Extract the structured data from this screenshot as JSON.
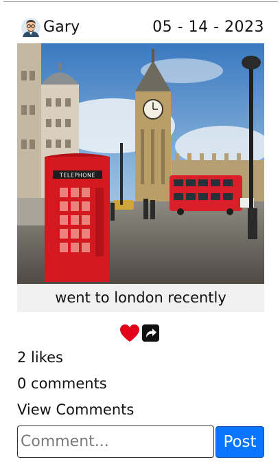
{
  "post": {
    "author": "Gary",
    "date": "05 - 14 - 2023",
    "caption": "went to london recently",
    "image_description": "",
    "likes_text": "2 likes",
    "comments_text": "0 comments",
    "view_comments_label": "View Comments"
  },
  "comment_form": {
    "placeholder": "Comment...",
    "value": "",
    "submit_label": "Post"
  },
  "icons": {
    "avatar": "avatar-icon",
    "like": "heart-icon",
    "share": "share-icon"
  },
  "colors": {
    "like": "#e3001b",
    "post_button": "#0a75ff",
    "caption_background": "#f0f0f0"
  }
}
